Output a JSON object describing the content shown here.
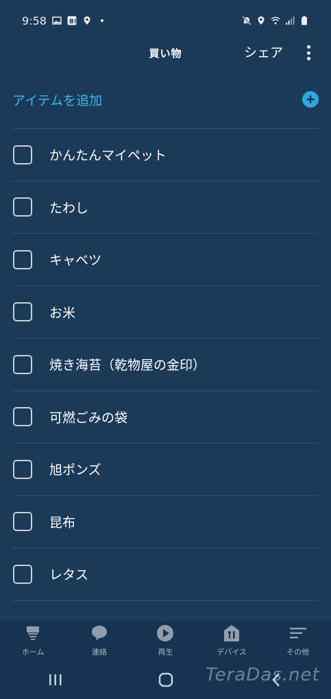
{
  "status_bar": {
    "time": "9:58",
    "left_icons": [
      "image-icon",
      "hatena-bookmark-icon",
      "location-icon",
      "dot-icon"
    ],
    "right_icons": [
      "mute-icon",
      "location-icon",
      "wifi-icon",
      "signal-icon",
      "battery-icon"
    ]
  },
  "header": {
    "title": "買い物",
    "share_label": "シェア"
  },
  "add_item": {
    "label": "アイテムを追加"
  },
  "items": [
    {
      "label": "かんたんマイペット",
      "checked": false
    },
    {
      "label": "たわし",
      "checked": false
    },
    {
      "label": "キャベツ",
      "checked": false
    },
    {
      "label": "お米",
      "checked": false
    },
    {
      "label": "焼き海苔（乾物屋の金印）",
      "checked": false
    },
    {
      "label": "可燃ごみの袋",
      "checked": false
    },
    {
      "label": "旭ポンズ",
      "checked": false
    },
    {
      "label": "昆布",
      "checked": false
    },
    {
      "label": "レタス",
      "checked": false
    }
  ],
  "bottom_nav": [
    {
      "label": "ホーム",
      "icon": "home-icon"
    },
    {
      "label": "連絡",
      "icon": "chat-icon"
    },
    {
      "label": "再生",
      "icon": "play-icon"
    },
    {
      "label": "デバイス",
      "icon": "devices-icon"
    },
    {
      "label": "その他",
      "icon": "menu-icon"
    }
  ],
  "watermark": "TeraDas.net",
  "colors": {
    "background": "#1a3a57",
    "accent": "#27a9e1",
    "divider": "#35536f"
  }
}
